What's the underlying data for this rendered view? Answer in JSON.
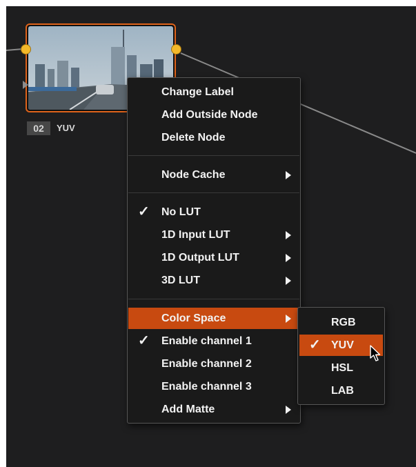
{
  "node": {
    "number": "02",
    "color_space": "YUV",
    "thumbnail": "city-highway-thumbnail"
  },
  "context_menu": {
    "groups": [
      [
        {
          "label": "Change Label"
        },
        {
          "label": "Add Outside Node"
        },
        {
          "label": "Delete Node"
        }
      ],
      [
        {
          "label": "Node Cache",
          "submenu": true
        }
      ],
      [
        {
          "label": "No LUT",
          "checked": true
        },
        {
          "label": "1D Input LUT",
          "submenu": true
        },
        {
          "label": "1D Output LUT",
          "submenu": true
        },
        {
          "label": "3D LUT",
          "submenu": true
        }
      ],
      [
        {
          "label": "Color Space",
          "submenu": true,
          "highlighted": true
        },
        {
          "label": "Enable channel 1",
          "checked": true
        },
        {
          "label": "Enable channel 2"
        },
        {
          "label": "Enable channel 3"
        },
        {
          "label": "Add Matte",
          "submenu": true
        }
      ]
    ]
  },
  "color_space_submenu": {
    "items": [
      {
        "label": "RGB"
      },
      {
        "label": "YUV",
        "checked": true,
        "highlighted": true
      },
      {
        "label": "HSL"
      },
      {
        "label": "LAB"
      }
    ]
  },
  "glyphs": {
    "check": "✓"
  },
  "colors": {
    "highlight": "#c84a10",
    "node_border": "#e0631a",
    "port": "#f4b92a",
    "background": "#1e1e1f",
    "menu_bg": "#1a1a1a"
  }
}
